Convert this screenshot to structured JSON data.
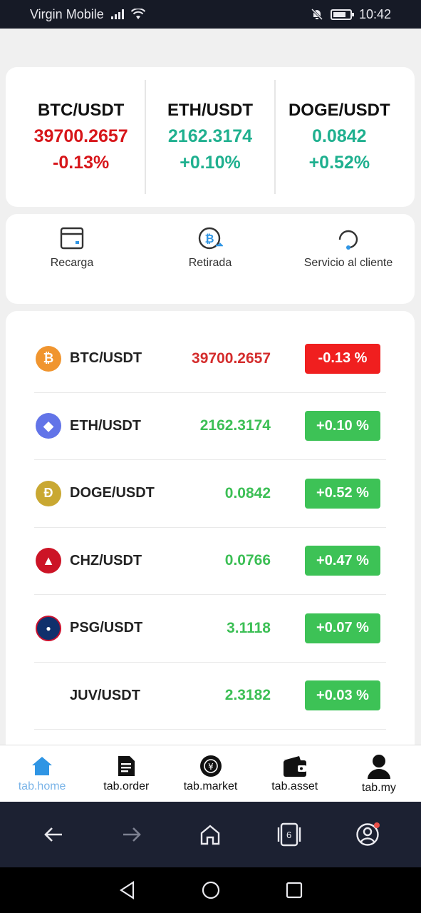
{
  "status_bar": {
    "carrier": "Virgin Mobile",
    "time": "10:42"
  },
  "tickers": [
    {
      "pair": "BTC/USDT",
      "price": "39700.2657",
      "change": "-0.13%",
      "trend": "down"
    },
    {
      "pair": "ETH/USDT",
      "price": "2162.3174",
      "change": "+0.10%",
      "trend": "up"
    },
    {
      "pair": "DOGE/USDT",
      "price": "0.0842",
      "change": "+0.52%",
      "trend": "up"
    }
  ],
  "actions": [
    {
      "label": "Recarga",
      "icon": "wallet-card-icon"
    },
    {
      "label": "Retirada",
      "icon": "bitcoin-withdraw-icon"
    },
    {
      "label": "Servicio al cliente",
      "icon": "headset-icon"
    }
  ],
  "market": [
    {
      "symbol": "BTC/USDT",
      "price": "39700.2657",
      "change": "-0.13 %",
      "trend": "down",
      "icon": "bitcoin-icon",
      "icon_color": "#f0952f",
      "icon_glyph": "₿"
    },
    {
      "symbol": "ETH/USDT",
      "price": "2162.3174",
      "change": "+0.10 %",
      "trend": "up",
      "icon": "ethereum-icon",
      "icon_color": "#6274e8",
      "icon_glyph": "◆"
    },
    {
      "symbol": "DOGE/USDT",
      "price": "0.0842",
      "change": "+0.52 %",
      "trend": "up",
      "icon": "dogecoin-icon",
      "icon_color": "#c9a832",
      "icon_glyph": "Ð"
    },
    {
      "symbol": "CHZ/USDT",
      "price": "0.0766",
      "change": "+0.47 %",
      "trend": "up",
      "icon": "chiliz-icon",
      "icon_color": "#cc1426",
      "icon_glyph": "▲"
    },
    {
      "symbol": "PSG/USDT",
      "price": "3.1118",
      "change": "+0.07 %",
      "trend": "up",
      "icon": "psg-icon",
      "icon_color": "#10306c",
      "icon_glyph": "●"
    },
    {
      "symbol": "JUV/USDT",
      "price": "2.3182",
      "change": "+0.03 %",
      "trend": "up",
      "icon": "",
      "icon_color": "",
      "icon_glyph": ""
    }
  ],
  "tabs": [
    {
      "label": "tab.home",
      "icon": "home-icon",
      "active": true
    },
    {
      "label": "tab.order",
      "icon": "document-icon",
      "active": false
    },
    {
      "label": "tab.market",
      "icon": "market-coin-icon",
      "active": false
    },
    {
      "label": "tab.asset",
      "icon": "wallet-icon",
      "active": false
    },
    {
      "label": "tab.my",
      "icon": "user-icon",
      "active": false
    }
  ],
  "browser": {
    "tab_count": "6"
  },
  "colors": {
    "up": "#3dc256",
    "down": "#f01f1f",
    "ticker_up": "#1fb08f",
    "ticker_down": "#d7161a",
    "tab_active": "#2f95e4"
  }
}
